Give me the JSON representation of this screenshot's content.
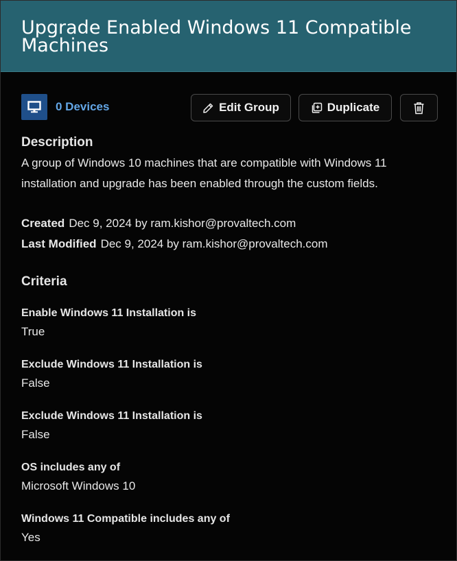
{
  "header": {
    "title": "Upgrade Enabled Windows 11 Compatible Machines"
  },
  "toolbar": {
    "device_icon": "monitor-icon",
    "device_count": "0 Devices",
    "edit_label": "Edit Group",
    "edit_icon": "pencil-icon",
    "duplicate_label": "Duplicate",
    "duplicate_icon": "duplicate-icon",
    "delete_icon": "trash-icon"
  },
  "description": {
    "title": "Description",
    "text": "A group of Windows 10 machines that are compatible with Windows 11 installation and upgrade has been enabled through the custom fields."
  },
  "meta": {
    "created_label": "Created",
    "created_value": "Dec 9, 2024 by ram.kishor@provaltech.com",
    "modified_label": "Last Modified",
    "modified_value": "Dec 9, 2024 by ram.kishor@provaltech.com"
  },
  "criteria": {
    "title": "Criteria",
    "items": [
      {
        "label": "Enable Windows 11 Installation is",
        "value": "True"
      },
      {
        "label": "Exclude Windows 11 Installation is",
        "value": "False"
      },
      {
        "label": "Exclude Windows 11 Installation is",
        "value": "False"
      },
      {
        "label": "OS includes any of",
        "value": "Microsoft Windows 10"
      },
      {
        "label": "Windows 11 Compatible includes any of",
        "value": "Yes"
      }
    ]
  },
  "colors": {
    "header_bg": "#266270",
    "page_bg": "#050505",
    "link": "#63a6e6",
    "device_icon_bg": "#1f4f8a"
  }
}
